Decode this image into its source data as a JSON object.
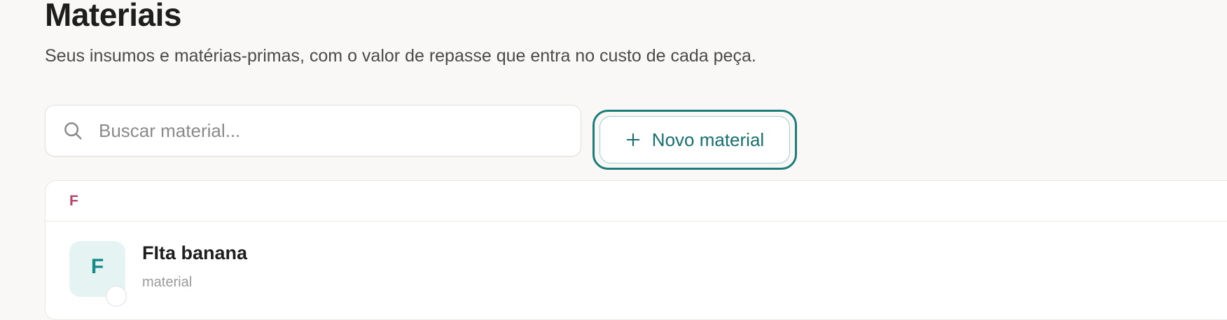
{
  "page": {
    "title": "Materiais",
    "subtitle": "Seus insumos e matérias-primas, com o valor de repasse que entra no custo de cada peça."
  },
  "search": {
    "placeholder": "Buscar material...",
    "value": "",
    "icon": "search-icon"
  },
  "toolbar": {
    "new_label": "Novo material",
    "new_icon": "plus-icon"
  },
  "list": {
    "groups": [
      {
        "letter": "F",
        "items": [
          {
            "initial": "F",
            "name": "FIta banana",
            "type": "material"
          }
        ]
      }
    ]
  },
  "colors": {
    "accent": "#1a7d7a",
    "group_letter": "#b0466c",
    "avatar_bg": "#e6f3f3",
    "background": "#f9f8f6"
  }
}
